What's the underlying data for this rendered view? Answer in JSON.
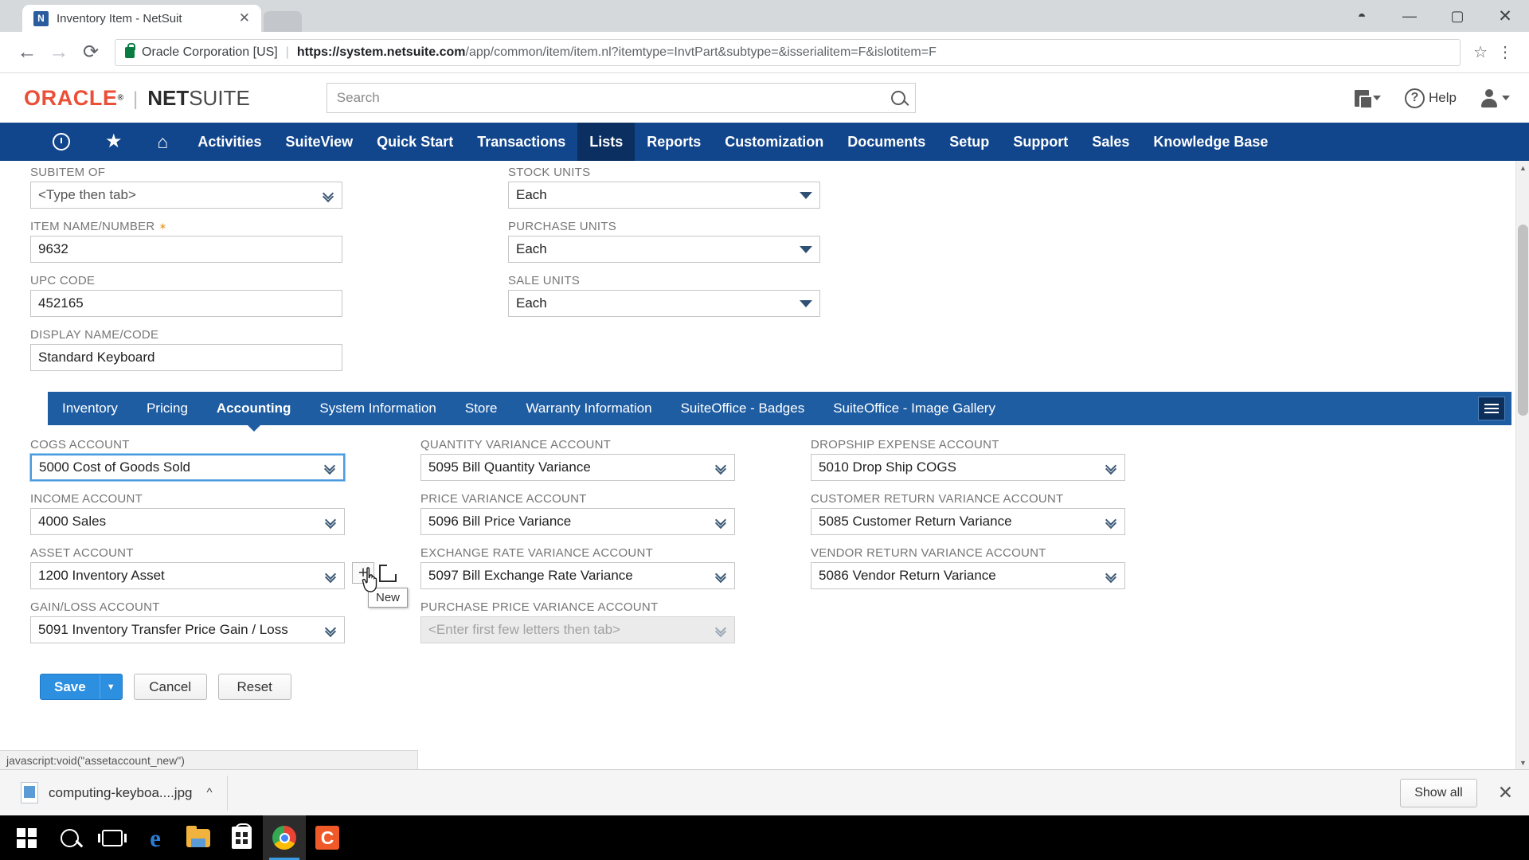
{
  "browser": {
    "tab": {
      "title": "Inventory Item - NetSuit",
      "close_label": "✕",
      "favicon": "netsuite-favicon"
    },
    "window_controls": {
      "account": "◓",
      "minimize": "—",
      "maximize": "▢",
      "close": "✕"
    },
    "nav": {
      "back": "←",
      "forward": "→",
      "reload": "⟳"
    },
    "omnibox": {
      "security_label": "Oracle Corporation [US]",
      "separator": "|",
      "url_domain": "https://system.netsuite.com",
      "url_path": "/app/common/item/item.nl?itemtype=InvtPart&subtype=&isserialitem=F&islotitem=F",
      "bookmark_star": "☆",
      "menu": "⋮"
    }
  },
  "netsuite_header": {
    "logo_oracle": "ORACLE",
    "logo_tm": "®",
    "logo_divider": "|",
    "logo_net": "NET",
    "logo_suite": "SUITE",
    "search_placeholder": "Search",
    "search_value": "",
    "help_label": "Help"
  },
  "main_nav": {
    "items": [
      {
        "label": "Activities",
        "active": false
      },
      {
        "label": "SuiteView",
        "active": false
      },
      {
        "label": "Quick Start",
        "active": false
      },
      {
        "label": "Transactions",
        "active": false
      },
      {
        "label": "Lists",
        "active": true
      },
      {
        "label": "Reports",
        "active": false
      },
      {
        "label": "Customization",
        "active": false
      },
      {
        "label": "Documents",
        "active": false
      },
      {
        "label": "Setup",
        "active": false
      },
      {
        "label": "Support",
        "active": false
      },
      {
        "label": "Sales",
        "active": false
      },
      {
        "label": "Knowledge Base",
        "active": false
      }
    ]
  },
  "top_form": {
    "left": [
      {
        "label": "SUBITEM OF",
        "value": "<Type then tab>",
        "control": "dblchevron",
        "required": false,
        "placeholder": true
      },
      {
        "label": "ITEM NAME/NUMBER",
        "value": "9632",
        "control": "text",
        "required": true
      },
      {
        "label": "UPC CODE",
        "value": "452165",
        "control": "text",
        "required": false
      },
      {
        "label": "DISPLAY NAME/CODE",
        "value": "Standard Keyboard",
        "control": "text",
        "required": false
      }
    ],
    "right": [
      {
        "label": "STOCK UNITS",
        "value": "Each",
        "control": "triangle"
      },
      {
        "label": "PURCHASE UNITS",
        "value": "Each",
        "control": "triangle"
      },
      {
        "label": "SALE UNITS",
        "value": "Each",
        "control": "triangle"
      }
    ]
  },
  "subtabs": {
    "items": [
      {
        "label": "Inventory",
        "active": false
      },
      {
        "label": "Pricing",
        "active": false
      },
      {
        "label": "Accounting",
        "active": true
      },
      {
        "label": "System Information",
        "active": false
      },
      {
        "label": "Store",
        "active": false
      },
      {
        "label": "Warranty Information",
        "active": false
      },
      {
        "label": "SuiteOffice - Badges",
        "active": false
      },
      {
        "label": "SuiteOffice - Image Gallery",
        "active": false
      }
    ],
    "menu_icon": "hamburger-icon"
  },
  "accounting": {
    "col1": [
      {
        "label": "COGS ACCOUNT",
        "value": "5000 Cost of Goods Sold",
        "focused": true,
        "disabled": false
      },
      {
        "label": "INCOME ACCOUNT",
        "value": "4000 Sales",
        "focused": false,
        "disabled": false
      },
      {
        "label": "ASSET ACCOUNT",
        "value": "1200 Inventory Asset",
        "focused": false,
        "disabled": false,
        "has_new_button": true
      },
      {
        "label": "GAIN/LOSS ACCOUNT",
        "value": "5091 Inventory Transfer Price Gain / Loss",
        "focused": false,
        "disabled": false
      }
    ],
    "col2": [
      {
        "label": "QUANTITY VARIANCE ACCOUNT",
        "value": "5095 Bill Quantity Variance",
        "disabled": false
      },
      {
        "label": "PRICE VARIANCE ACCOUNT",
        "value": "5096 Bill Price Variance",
        "disabled": false
      },
      {
        "label": "EXCHANGE RATE VARIANCE ACCOUNT",
        "value": "5097 Bill Exchange Rate Variance",
        "disabled": false
      },
      {
        "label": "PURCHASE PRICE VARIANCE ACCOUNT",
        "value": "<Enter first few letters then tab>",
        "disabled": true
      }
    ],
    "col3": [
      {
        "label": "DROPSHIP EXPENSE ACCOUNT",
        "value": "5010 Drop Ship COGS",
        "disabled": false
      },
      {
        "label": "CUSTOMER RETURN VARIANCE ACCOUNT",
        "value": "5085 Customer Return Variance",
        "disabled": false
      },
      {
        "label": "VENDOR RETURN VARIANCE ACCOUNT",
        "value": "5086 Vendor Return Variance",
        "disabled": false
      }
    ],
    "new_tooltip": "New",
    "new_button_label": "+",
    "popout_icon": "open-in-new-icon"
  },
  "actions": {
    "save_label": "Save",
    "save_dropdown": "▼",
    "cancel_label": "Cancel",
    "reset_label": "Reset"
  },
  "status_bar": {
    "text": "javascript:void(\"assetaccount_new\")"
  },
  "download_bar": {
    "file_name": "computing-keyboa....jpg",
    "file_caret": "^",
    "show_all_label": "Show all",
    "close_label": "✕"
  },
  "taskbar": {
    "items": [
      {
        "name": "start-button",
        "icon": "windows-logo-icon",
        "active": false
      },
      {
        "name": "search-button",
        "icon": "search-icon",
        "active": false
      },
      {
        "name": "task-view-button",
        "icon": "task-view-icon",
        "active": false
      },
      {
        "name": "edge-button",
        "icon": "edge-icon",
        "active": false
      },
      {
        "name": "file-explorer-button",
        "icon": "folder-icon",
        "active": false
      },
      {
        "name": "microsoft-store-button",
        "icon": "store-icon",
        "active": false
      },
      {
        "name": "chrome-button",
        "icon": "chrome-icon",
        "active": true
      },
      {
        "name": "camtasia-button",
        "icon": "camtasia-icon",
        "active": false
      }
    ],
    "edge_glyph": "e",
    "camtasia_glyph": "C"
  }
}
